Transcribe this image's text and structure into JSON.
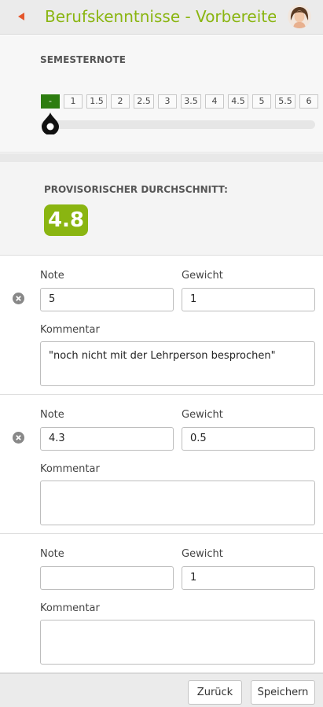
{
  "header": {
    "title": "Berufskenntnisse - Vorbereite...",
    "accent_color": "#8ab511",
    "back_icon": "back-arrow-icon",
    "avatar": "user-avatar"
  },
  "semester": {
    "label": "SEMESTERNOTE",
    "scale": [
      "-",
      "1",
      "1.5",
      "2",
      "2.5",
      "3",
      "3.5",
      "4",
      "4.5",
      "5",
      "5.5",
      "6"
    ],
    "selected": "-",
    "slider_value": 0,
    "selected_color": "#2d7d10"
  },
  "average": {
    "label": "PROVISORISCHER DURCHSCHNITT:",
    "value": "4.8",
    "badge_color": "#8ab511"
  },
  "entries": [
    {
      "note_label": "Note",
      "weight_label": "Gewicht",
      "comment_label": "Kommentar",
      "note": "5",
      "weight": "1",
      "comment": "\"noch nicht mit der Lehrperson besprochen\"",
      "removable": true
    },
    {
      "note_label": "Note",
      "weight_label": "Gewicht",
      "comment_label": "Kommentar",
      "note": "4.3",
      "weight": "0.5",
      "comment": "",
      "removable": true
    },
    {
      "note_label": "Note",
      "weight_label": "Gewicht",
      "comment_label": "Kommentar",
      "note": "",
      "weight": "1",
      "comment": "",
      "removable": false
    }
  ],
  "footer": {
    "back_label": "Zurück",
    "save_label": "Speichern"
  }
}
